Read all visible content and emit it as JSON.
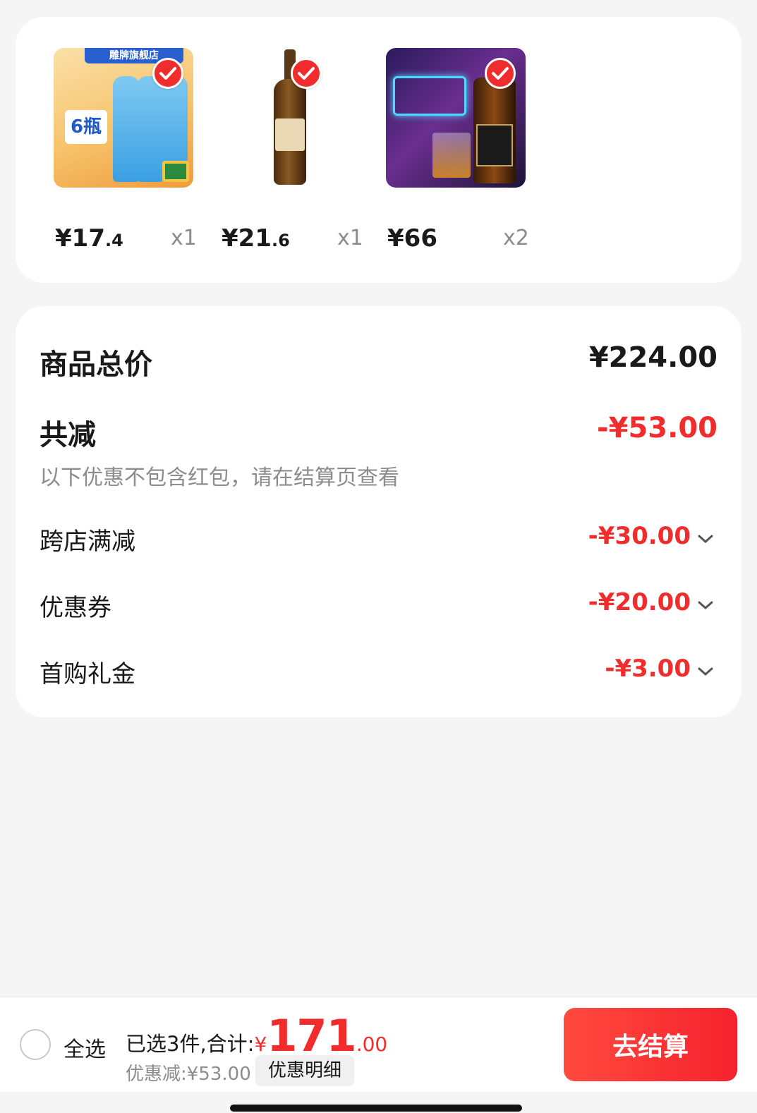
{
  "products": [
    {
      "price_int": "¥17",
      "price_cents": ".4",
      "qty": "x1",
      "image_alt": "detergent bottles",
      "banner": "雕牌旗舰店",
      "badge": "6瓶"
    },
    {
      "price_int": "¥21",
      "price_cents": ".6",
      "qty": "x1",
      "image_alt": "vinegar bottle"
    },
    {
      "price_int": "¥66",
      "price_cents": "",
      "qty": "x2",
      "image_alt": "whisky bottle"
    }
  ],
  "summary": {
    "total_label": "商品总价",
    "total_value": "¥224.00",
    "discount_label": "共减",
    "discount_value": "-¥53.00",
    "notice": "以下优惠不包含红包，请在结算页查看",
    "details": [
      {
        "label": "跨店满减",
        "value": "-¥30.00"
      },
      {
        "label": "优惠券",
        "value": "-¥20.00"
      },
      {
        "label": "首购礼金",
        "value": "-¥3.00"
      }
    ]
  },
  "bottom_bar": {
    "select_all": "全选",
    "selected_text": "已选3件,合计:",
    "currency": "¥",
    "total_int": "171",
    "total_cents": ".00",
    "saved_text": "优惠减:¥53.00",
    "detail_button": "优惠明细",
    "checkout_button": "去结算"
  },
  "colors": {
    "accent": "#f02c2c",
    "checkout_start": "#ff4a3e",
    "checkout_end": "#f5222d",
    "muted": "#8c8c8c"
  }
}
